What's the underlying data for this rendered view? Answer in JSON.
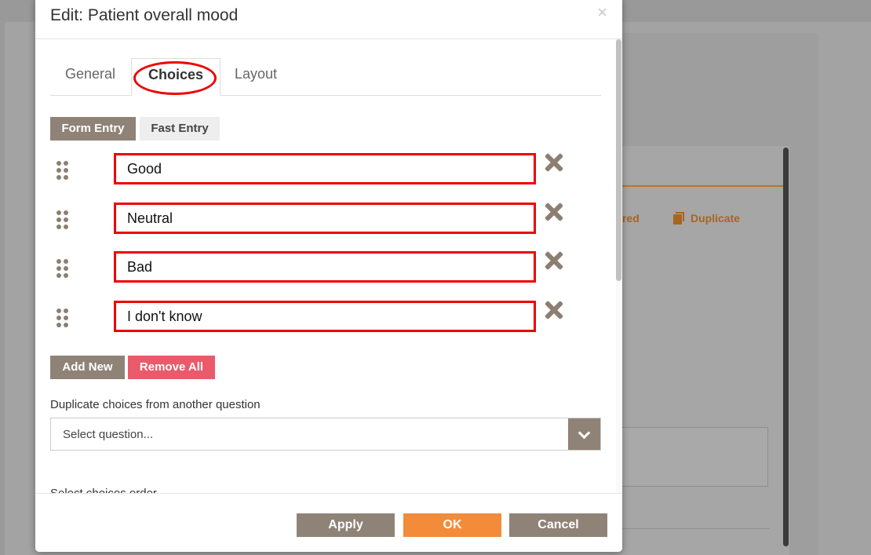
{
  "modal": {
    "title": "Edit: Patient overall mood",
    "close_symbol": "×"
  },
  "tabs": [
    {
      "label": "General",
      "active": false
    },
    {
      "label": "Choices",
      "active": true
    },
    {
      "label": "Layout",
      "active": false
    }
  ],
  "entry_modes": {
    "form_entry": "Form Entry",
    "fast_entry": "Fast Entry"
  },
  "choices": [
    "Good",
    "Neutral",
    "Bad",
    "I don't know"
  ],
  "actions": {
    "add_new": "Add New",
    "remove_all": "Remove All"
  },
  "duplicate": {
    "label": "Duplicate choices from another question",
    "select_text": "Select question..."
  },
  "order": {
    "label": "Select choices order"
  },
  "footer": {
    "apply": "Apply",
    "ok": "OK",
    "cancel": "Cancel"
  },
  "background": {
    "link_partial": "red",
    "duplicate_link": "Duplicate"
  },
  "colors": {
    "brand_taupe": "#8f8377",
    "ok_orange": "#f38c3a",
    "remove_red": "#ea5a6a",
    "highlight_red": "#e00000"
  },
  "icons": {
    "drag": "drag-handle-icon",
    "remove": "remove-choice-icon",
    "close": "close-icon",
    "dropdown": "chevron-down-icon"
  }
}
